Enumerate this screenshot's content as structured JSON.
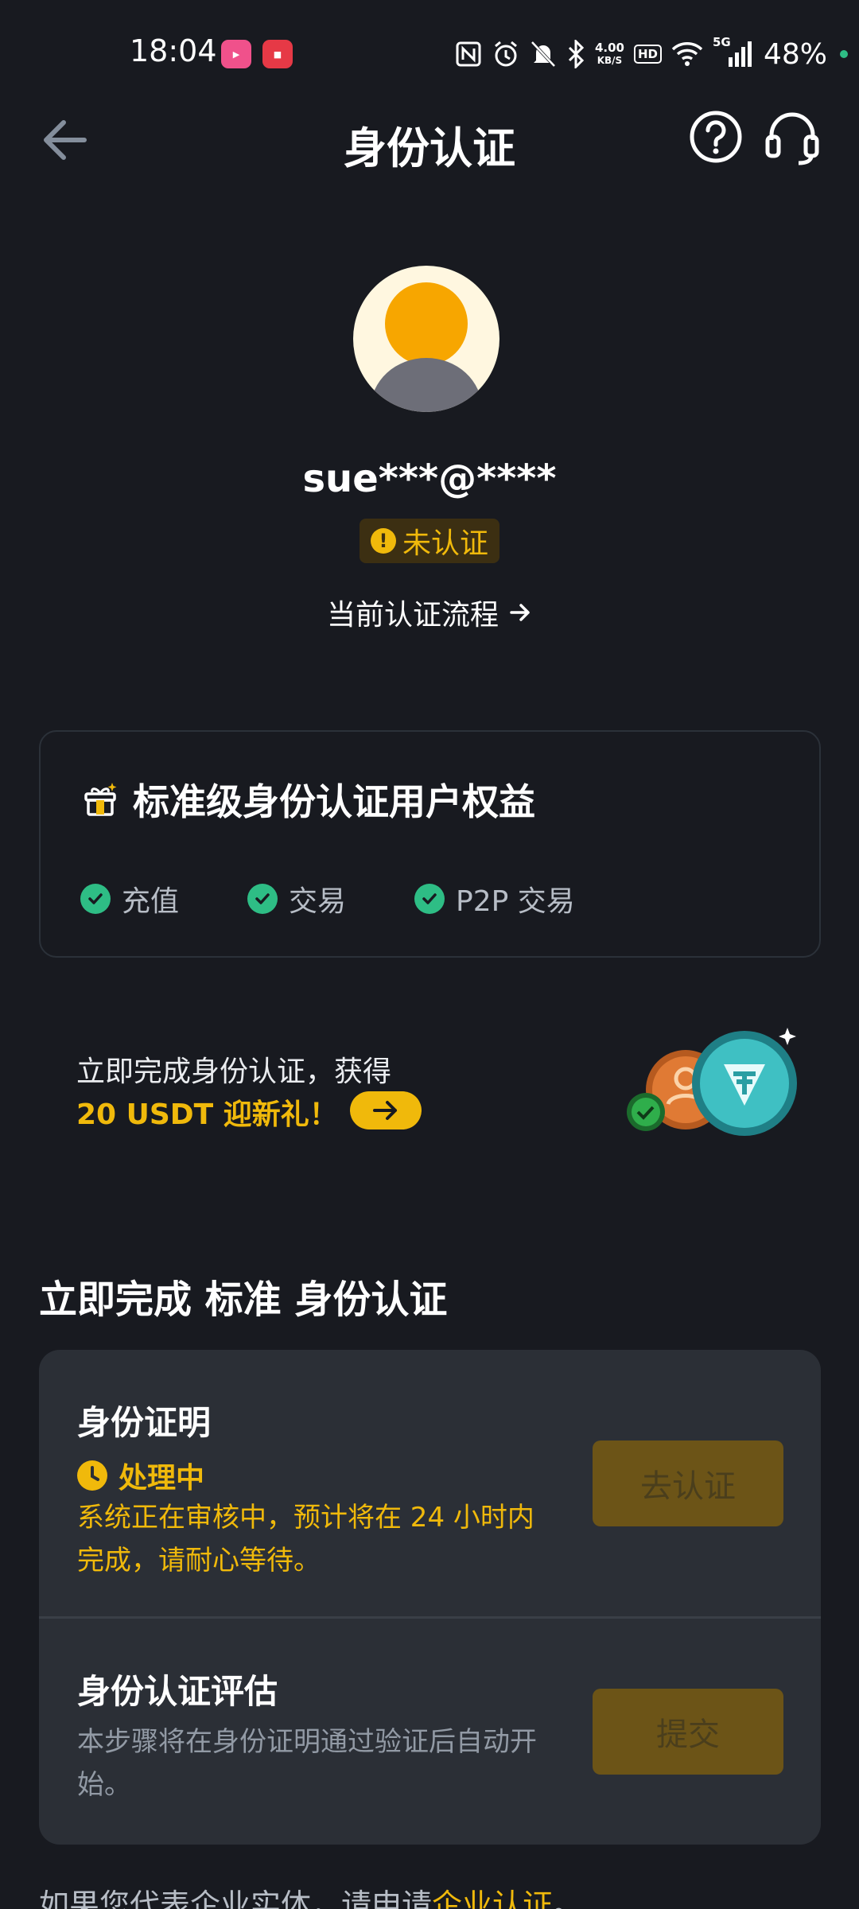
{
  "status_bar": {
    "time": "18:04",
    "net_speed_value": "4.00",
    "net_speed_unit": "KB/S",
    "hd": "HD",
    "network": "5G",
    "battery": "48%",
    "app_icons": [
      "bilibili-app-icon",
      "video-recorder-app-icon"
    ],
    "status_icons": [
      "nfc-icon",
      "alarm-icon",
      "mute-bell-icon",
      "bluetooth-icon",
      "wifi-icon",
      "signal-icon"
    ]
  },
  "header": {
    "title": "身份认证",
    "back_icon": "back-arrow-icon",
    "help_icon": "help-circle-icon",
    "support_icon": "headset-icon"
  },
  "profile": {
    "username": "sue***@****",
    "status": "未认证",
    "flow_link": "当前认证流程"
  },
  "benefits": {
    "title": "标准级身份认证用户权益",
    "items": [
      "充值",
      "交易",
      "P2P 交易"
    ]
  },
  "promo": {
    "line1": "立即完成身份认证，获得",
    "line2": "20 USDT 迎新礼！"
  },
  "section": {
    "title": "立即完成 标准 身份认证"
  },
  "steps": [
    {
      "title": "身份证明",
      "status": "处理中",
      "desc": "系统正在审核中，预计将在 24 小时内完成，请耐心等待。",
      "button": "去认证"
    },
    {
      "title": "身份认证评估",
      "desc": "本步骤将在身份证明通过验证后自动开始。",
      "button": "提交"
    }
  ],
  "footer": {
    "text": "如果您代表企业实体，请申请",
    "link": "企业认证",
    "end": "。"
  },
  "colors": {
    "background": "#181A20",
    "accent": "#F0B90B",
    "success": "#2EBD85",
    "card": "#2B2F36"
  }
}
